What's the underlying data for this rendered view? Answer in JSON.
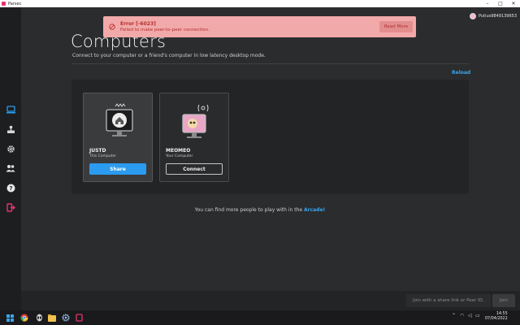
{
  "window": {
    "title": "Parsec",
    "controls": [
      "–",
      "□",
      "✕"
    ]
  },
  "account": {
    "username": "Putius9849139653"
  },
  "error_toast": {
    "title": "Error [-6023]",
    "message": "Failed to make peer-to-peer connection.",
    "read_more_label": "Read More"
  },
  "page": {
    "title": "Computers",
    "subtitle": "Connect to your computer or a friend's computer in low latency desktop mode.",
    "reload_label": "Reload"
  },
  "computers": [
    {
      "name": "JUSTD",
      "description": "This Computer",
      "button_label": "Share",
      "button_style": "primary",
      "icon": "home-monitor-icon"
    },
    {
      "name": "MEOMEO",
      "description": "Your Computer",
      "button_label": "Connect",
      "button_style": "outline",
      "icon": "streaming-monitor-icon"
    }
  ],
  "arcade_note": {
    "prefix": "You can find more people to play with in the",
    "link": "Arcade!"
  },
  "join": {
    "placeholder": "Join with a share link or Peer ID.",
    "button_label": "Join"
  },
  "sidebar": [
    {
      "name": "computers",
      "icon": "monitor-icon",
      "active": true
    },
    {
      "name": "arcade",
      "icon": "arcade-icon",
      "active": false
    },
    {
      "name": "settings",
      "icon": "gear-icon",
      "active": false
    },
    {
      "name": "friends",
      "icon": "users-icon",
      "active": false
    },
    {
      "name": "help",
      "icon": "help-icon",
      "active": false
    },
    {
      "name": "logout",
      "icon": "logout-icon",
      "active": false
    }
  ],
  "taskbar": {
    "apps": [
      "windows-start-icon",
      "chrome-icon",
      "alien-icon",
      "file-explorer-icon",
      "settings-app-icon",
      "parsec-icon"
    ],
    "time": "14:55",
    "date": "07/04/2022"
  },
  "colors": {
    "accent": "#3aa5f0",
    "error_bg": "#f2a9a9",
    "error_text": "#b23030",
    "active_icon": "#2b9bf0",
    "logout_icon": "#e5326d"
  }
}
